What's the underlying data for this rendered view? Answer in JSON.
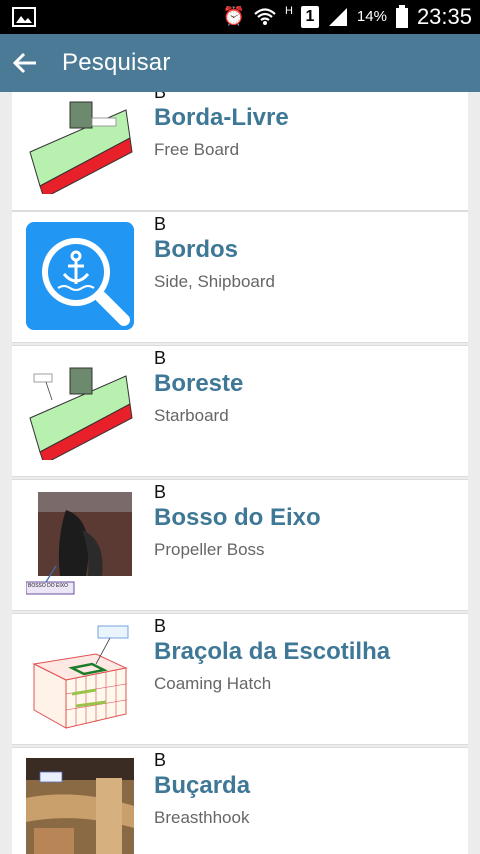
{
  "status_bar": {
    "icons": [
      "image-icon",
      "alarm-icon",
      "wifi-icon",
      "h-icon",
      "sim-1-icon",
      "signal-icon",
      "battery-icon"
    ],
    "network_letter": "H",
    "sim": "1",
    "battery": "14%",
    "time": "23:35"
  },
  "app_bar": {
    "title": "Pesquisar",
    "color": "#4a7a96"
  },
  "items": [
    {
      "letter": "B",
      "term": "Borda-Livre",
      "translation": "Free Board",
      "thumb": "ship-freeboard-diagram"
    },
    {
      "letter": "B",
      "term": "Bordos",
      "translation": "Side, Shipboard",
      "thumb": "ship-search-icon"
    },
    {
      "letter": "B",
      "term": "Boreste",
      "translation": "Starboard",
      "thumb": "ship-starboard-diagram"
    },
    {
      "letter": "B",
      "term": "Bosso do Eixo",
      "translation": "Propeller Boss",
      "thumb": "propeller-boss-photo",
      "thumb_label": "BOSSO DO EIXO"
    },
    {
      "letter": "B",
      "term": "Braçola da Escotilha",
      "translation": "Coaming Hatch",
      "thumb": "hatch-coaming-diagram"
    },
    {
      "letter": "B",
      "term": "Buçarda",
      "translation": "Breasthhook",
      "thumb": "breasthook-photo"
    }
  ]
}
